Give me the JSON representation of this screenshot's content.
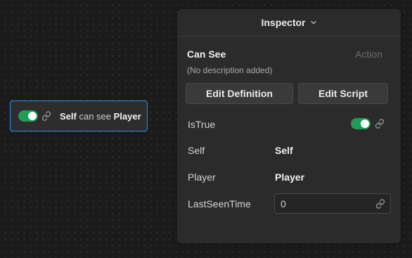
{
  "node": {
    "enabled": true,
    "subject": "Self",
    "verb": "can see",
    "object": "Player"
  },
  "inspector": {
    "title": "Inspector",
    "node_name": "Can See",
    "node_type": "Action",
    "description": "(No description added)",
    "edit_definition_label": "Edit Definition",
    "edit_script_label": "Edit Script",
    "properties": {
      "is_true": {
        "label": "IsTrue",
        "value": true
      },
      "self": {
        "label": "Self",
        "value": "Self"
      },
      "player": {
        "label": "Player",
        "value": "Player"
      },
      "last_seen_time": {
        "label": "LastSeenTime",
        "value": "0"
      }
    }
  },
  "colors": {
    "toggle_on": "#1f9d55",
    "selection_border": "#2d8df0",
    "panel_bg": "#2b2b2b"
  },
  "icons": {
    "link": "link-icon",
    "chevron": "chevron-down-icon"
  }
}
